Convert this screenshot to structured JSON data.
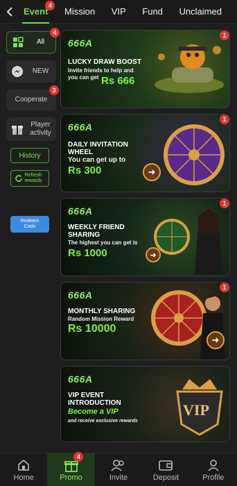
{
  "header": {
    "back_icon": "chevron-left-icon",
    "tabs": [
      {
        "label": "Event",
        "badge": "4",
        "active": true
      },
      {
        "label": "Mission"
      },
      {
        "label": "VIP"
      },
      {
        "label": "Fund"
      },
      {
        "label": "Unclaimed"
      }
    ]
  },
  "sidebar": {
    "all": {
      "label": "All",
      "badge": "4"
    },
    "new": {
      "label": "NEW"
    },
    "cooperate": {
      "label": "Cooperate",
      "badge": "3"
    },
    "player_activity": {
      "label": "Player activity"
    },
    "history": {
      "label": "History"
    },
    "refresh": {
      "label": "Refresh rewards"
    },
    "redeem": {
      "label": "Redeem Code"
    }
  },
  "cards": [
    {
      "logo": "666A",
      "title": "LUCKY DRAW BOOST",
      "sub": "Invite friends to help and you can get",
      "amount": "Rs 666",
      "badge": "1"
    },
    {
      "logo": "666A",
      "title": "DAILY INVITATION WHEEL",
      "sub": "You can get up to",
      "amount": "Rs 300",
      "badge": "1"
    },
    {
      "logo": "666A",
      "title": "WEEKLY FRIEND SHARING",
      "sub": "The highest you can get is",
      "amount": "Rs 1000",
      "badge": "1"
    },
    {
      "logo": "666A",
      "title": "MONTHLY SHARING",
      "sub": "Random Mission Reward",
      "amount": "Rs 10000",
      "badge": "1"
    },
    {
      "logo": "666A",
      "title": "VIP EVENT INTRODUCTION",
      "sub": "Become a VIP",
      "sub2": "and receive exclusive rewards",
      "emblem": "VIP"
    }
  ],
  "bottom_nav": [
    {
      "label": "Home",
      "icon": "home-icon"
    },
    {
      "label": "Promo",
      "icon": "gift-icon",
      "badge": "4",
      "active": true
    },
    {
      "label": "Invite",
      "icon": "people-icon"
    },
    {
      "label": "Deposit",
      "icon": "wallet-icon"
    },
    {
      "label": "Profile",
      "icon": "person-icon"
    }
  ],
  "colors": {
    "accent": "#6fe04a",
    "badge": "#e23434",
    "background": "#1e1e1e"
  }
}
